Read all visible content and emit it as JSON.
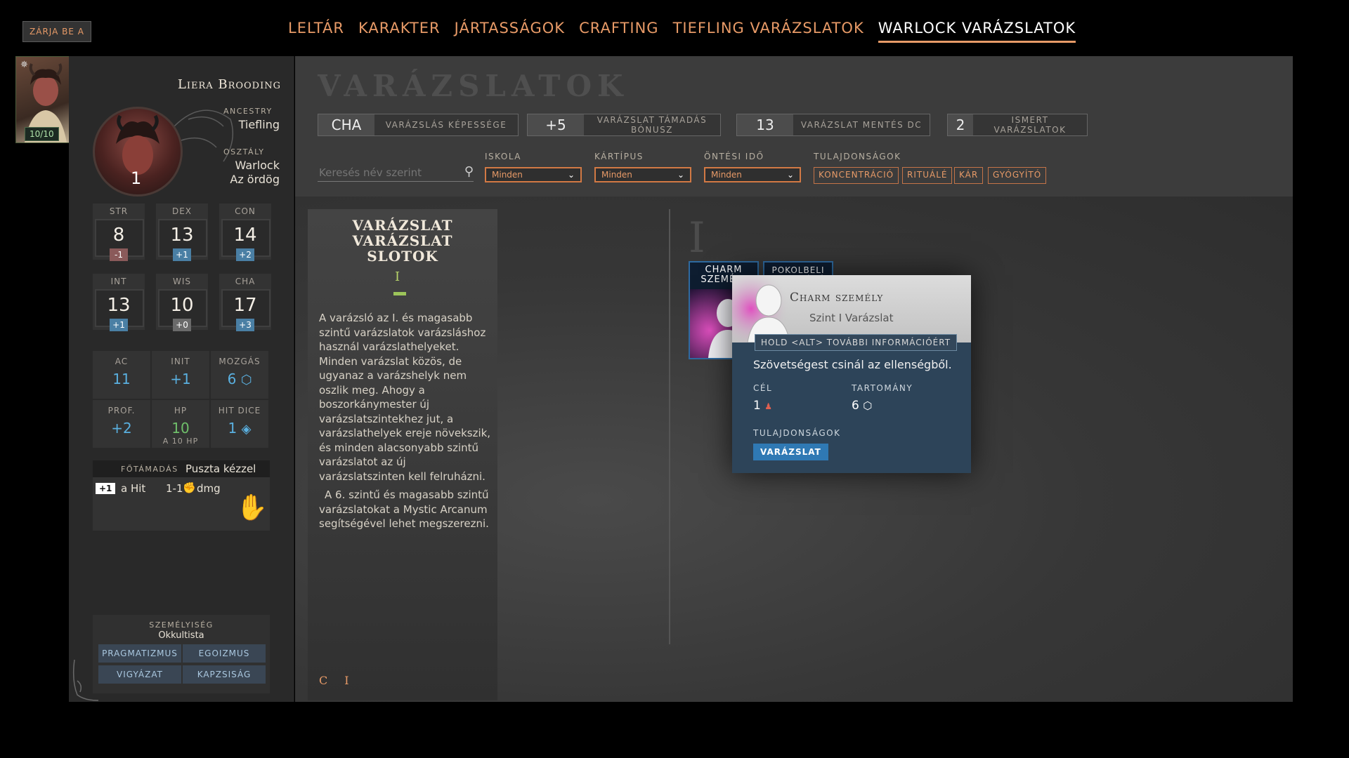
{
  "top": {
    "close_label": "ZÁRJA BE A",
    "tabs": [
      "LELTÁR",
      "KARAKTER",
      "JÁRTASSÁGOK",
      "CRAFTING",
      "TIEFLING VARÁZSLATOK",
      "WARLOCK VARÁZSLATOK"
    ],
    "active_tab": "WARLOCK VARÁZSLATOK"
  },
  "portrait_card": {
    "hp": "10/10",
    "hp_fraction": 1.0
  },
  "character": {
    "name": "Liera Brooding",
    "level": "1",
    "ancestry_label": "ANCESTRY",
    "ancestry": "Tiefling",
    "class_label": "OSZTÁLY",
    "class_name": "Warlock",
    "subclass": "Az ördög"
  },
  "abilities": [
    {
      "name": "STR",
      "value": "8",
      "mod": "-1"
    },
    {
      "name": "DEX",
      "value": "13",
      "mod": "+1"
    },
    {
      "name": "CON",
      "value": "14",
      "mod": "+2"
    },
    {
      "name": "INT",
      "value": "13",
      "mod": "+1"
    },
    {
      "name": "WIS",
      "value": "10",
      "mod": "+0"
    },
    {
      "name": "CHA",
      "value": "17",
      "mod": "+3"
    }
  ],
  "stats": [
    {
      "name": "AC",
      "value": "11",
      "sub": ""
    },
    {
      "name": "INIT",
      "value": "+1",
      "sub": ""
    },
    {
      "name": "MOZGÁS",
      "value": "6",
      "sub": ""
    },
    {
      "name": "PROF.",
      "value": "+2",
      "sub": ""
    },
    {
      "name": "HP",
      "value": "10",
      "sub": "A 10 HP"
    },
    {
      "name": "HIT DICE",
      "value": "1",
      "sub": ""
    }
  ],
  "attack": {
    "label": "FŐTÁMADÁS",
    "weapon": "Puszta kézzel",
    "hit_bonus": "+1",
    "hit_label": "a Hit",
    "damage": "1-1",
    "damage_label": "dmg"
  },
  "personality": {
    "label": "SZEMÉLYISÉG",
    "value": "Okkultista",
    "tags": [
      "PRAGMATIZMUS",
      "EGOIZMUS",
      "VIGYÁZAT",
      "KAPZSISÁG"
    ]
  },
  "main": {
    "title": "VARÁZSLATOK",
    "statbars": [
      {
        "num": "CHA",
        "label": "VARÁZSLÁS KÉPESSÉGE"
      },
      {
        "num": "+5",
        "label": "VARÁZSLAT TÁMADÁS BÓNUSZ"
      },
      {
        "num": "13",
        "label": "VARÁZSLAT MENTÉS DC"
      },
      {
        "num": "2",
        "label": "ISMERT VARÁZSLATOK"
      }
    ],
    "search_placeholder": "Keresés név szerint",
    "filters": [
      {
        "label": "ISKOLA",
        "value": "Minden"
      },
      {
        "label": "KÁRTÍPUS",
        "value": "Minden"
      },
      {
        "label": "ÖNTÉSI IDŐ",
        "value": "Minden"
      }
    ],
    "properties_label": "TULAJDONSÁGOK",
    "property_chips": [
      "KONCENTRÁCIÓ",
      "RITUÁLÉ",
      "KÁR",
      "GYÓGYÍTÓ"
    ],
    "slots": {
      "title": "VARÁZSLAT VARÁZSLAT SLOTOK",
      "level": "I",
      "text1": "A varázsló az I. és magasabb szintű varázslatok varázsláshoz használ varázslathelyeket. Minden varázslat közös, de ugyanaz a varázshelyk nem oszlik meg. Ahogy a boszorkánymester új varázslatszintekhez jut, a varázslathelyek ereje növekszik, és minden alacsonyabb szintű varázslatot az új varázslatszinten kell felruházni.",
      "text2": "A 6. szintű és magasabb szintű varázslatokat a Mystic Arcanum segítségével lehet megszerezni."
    },
    "level_heading": "I",
    "spells": [
      "CHARM SZEMÉLY",
      "POKOLBELI VISSZAVÁGÁS"
    ],
    "bottom_tabs": [
      "C",
      "I"
    ]
  },
  "tooltip": {
    "name": "Charm személy",
    "subtitle": "Szint I Varázslat",
    "hold": "HOLD <ALT> TOVÁBBI INFORMÁCIÓÉRT",
    "desc": "Szövetségest csinál az ellenségből.",
    "target_label": "CÉL",
    "target_value": "1",
    "range_label": "TARTOMÁNY",
    "range_value": "6",
    "props_label": "TULAJDONSÁGOK",
    "tag": "VARÁZSLAT"
  },
  "colors": {
    "accent": "#e79a67",
    "stat_blue": "#5ab0e0",
    "mod_positive": "#4a7fa4",
    "mod_negative": "#8a5a5a",
    "tooltip_bg": "#2d4459",
    "spell_border": "#2e6aa0"
  }
}
